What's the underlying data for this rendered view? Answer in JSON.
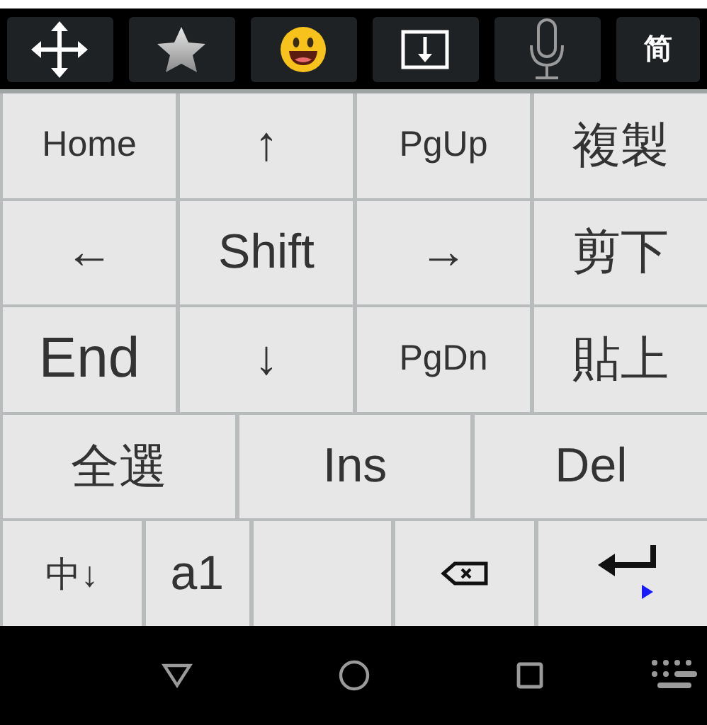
{
  "toolbar": [
    {
      "kind": "move"
    },
    {
      "kind": "star"
    },
    {
      "kind": "emoji"
    },
    {
      "kind": "panel"
    },
    {
      "kind": "mic"
    },
    {
      "kind": "text",
      "label": "简"
    }
  ],
  "rows": [
    [
      {
        "kind": "word",
        "label": "Home"
      },
      {
        "kind": "key",
        "label": "↑"
      },
      {
        "kind": "word",
        "label": "PgUp"
      },
      {
        "kind": "key",
        "label": "複製"
      }
    ],
    [
      {
        "kind": "key",
        "label": "←"
      },
      {
        "kind": "key",
        "label": "Shift"
      },
      {
        "kind": "key",
        "label": "→"
      },
      {
        "kind": "key",
        "label": "剪下"
      }
    ],
    [
      {
        "kind": "big",
        "label": "End"
      },
      {
        "kind": "key",
        "label": "↓"
      },
      {
        "kind": "word",
        "label": "PgDn"
      },
      {
        "kind": "key",
        "label": "貼上"
      }
    ],
    [
      {
        "kind": "key",
        "label": "全選"
      },
      {
        "kind": "key",
        "label": "Ins"
      },
      {
        "kind": "key",
        "label": "Del"
      }
    ],
    [
      {
        "kind": "word",
        "label": "中↓"
      },
      {
        "kind": "key",
        "label": "a1"
      },
      {
        "kind": "space"
      },
      {
        "kind": "backspace"
      },
      {
        "kind": "enter"
      }
    ]
  ]
}
